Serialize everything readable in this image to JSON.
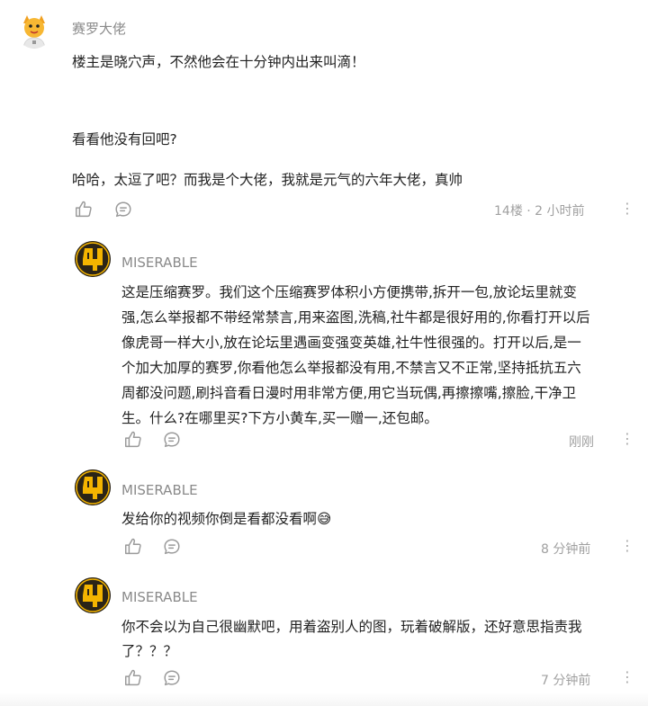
{
  "comment": {
    "username": "赛罗大佬",
    "paragraphs": [
      "楼主是晓穴声，不然他会在十分钟内出来叫滴！",
      "看看他没有回吧?",
      "哈哈，太逗了吧？而我是个大佬，我就是元气的六年大佬，真帅"
    ],
    "meta": "14楼 · 2 小时前",
    "more": "⋮"
  },
  "replies": [
    {
      "username": "MISERABLE",
      "lines": [
        "这是压缩赛罗。我们这个压缩赛罗体积小方便携带,拆开一包,放论坛里就变",
        "强,怎么举报都不带经常禁言,用来盗图,洗稿,社牛都是很好用的,你看打开以后",
        "像虎哥一样大小,放在论坛里遇画变强变英雄,社牛性很强的。打开以后,是一",
        "个加大加厚的赛罗,你看他怎么举报都没有用,不禁言又不正常,坚持抵抗五六",
        "周都没问题,刷抖音看日漫时用非常方便,用它当玩偶,再擦擦嘴,擦脸,干净卫",
        "生。什么?在哪里买?下方小黄车,买一赠一,还包邮。"
      ],
      "meta": "刚刚",
      "more": "⋮"
    },
    {
      "username": "MISERABLE",
      "lines": [
        "发给你的视频你倒是看都没看啊"
      ],
      "emoji": "😅",
      "meta": "8 分钟前",
      "more": "⋮"
    },
    {
      "username": "MISERABLE",
      "lines": [
        "你不会以为自己很幽默吧，用着盗别人的图，玩着破解版，还好意思指责我",
        "了？？？"
      ],
      "meta": "7 分钟前",
      "more": "⋮"
    }
  ],
  "icons": {
    "like": "thumbs-up-icon",
    "reply": "speech-bubble-icon",
    "more": "more-vertical-icon"
  },
  "colors": {
    "username": "#8a8a8a",
    "text": "#222222",
    "meta": "#a0a0a0",
    "icon": "#9a9a9a",
    "avatar_brand_bg": "#2b2417",
    "avatar_brand_fg": "#f4b400"
  }
}
